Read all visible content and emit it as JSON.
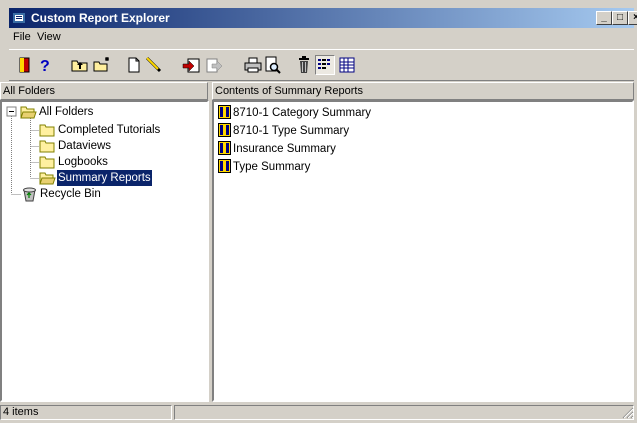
{
  "window": {
    "title": "Custom Report Explorer",
    "minimize": "_",
    "maximize": "□",
    "close": "×"
  },
  "menu": {
    "items": [
      "File",
      "View"
    ]
  },
  "toolbar": {
    "icons": [
      "exit-icon",
      "help-icon",
      "up-folder-icon",
      "new-folder-icon",
      "new-document-icon",
      "edit-icon",
      "import-icon",
      "export-icon",
      "print-icon",
      "print-preview-icon",
      "delete-icon",
      "list-view-icon",
      "details-view-icon"
    ]
  },
  "left_pane": {
    "header": "All Folders",
    "tree": [
      {
        "label": "All Folders",
        "icon": "open-folder-icon"
      },
      {
        "label": "Completed Tutorials",
        "icon": "folder-icon"
      },
      {
        "label": "Dataviews",
        "icon": "folder-icon"
      },
      {
        "label": "Logbooks",
        "icon": "folder-icon"
      },
      {
        "label": "Summary Reports",
        "icon": "open-folder-icon",
        "selected": true
      },
      {
        "label": "Recycle Bin",
        "icon": "recycle-bin-icon"
      }
    ]
  },
  "right_pane": {
    "header": "Contents of Summary Reports",
    "items": [
      {
        "label": "8710-1 Category Summary",
        "icon": "report-icon"
      },
      {
        "label": "8710-1 Type Summary",
        "icon": "report-icon"
      },
      {
        "label": "Insurance Summary",
        "icon": "report-icon"
      },
      {
        "label": "Type Summary",
        "icon": "report-icon"
      }
    ]
  },
  "status": {
    "count": "4 items"
  },
  "colors": {
    "titlebar_start": "#0a246a",
    "titlebar_end": "#a6caf0",
    "selection": "#0a246a",
    "face": "#d4d0c8"
  }
}
